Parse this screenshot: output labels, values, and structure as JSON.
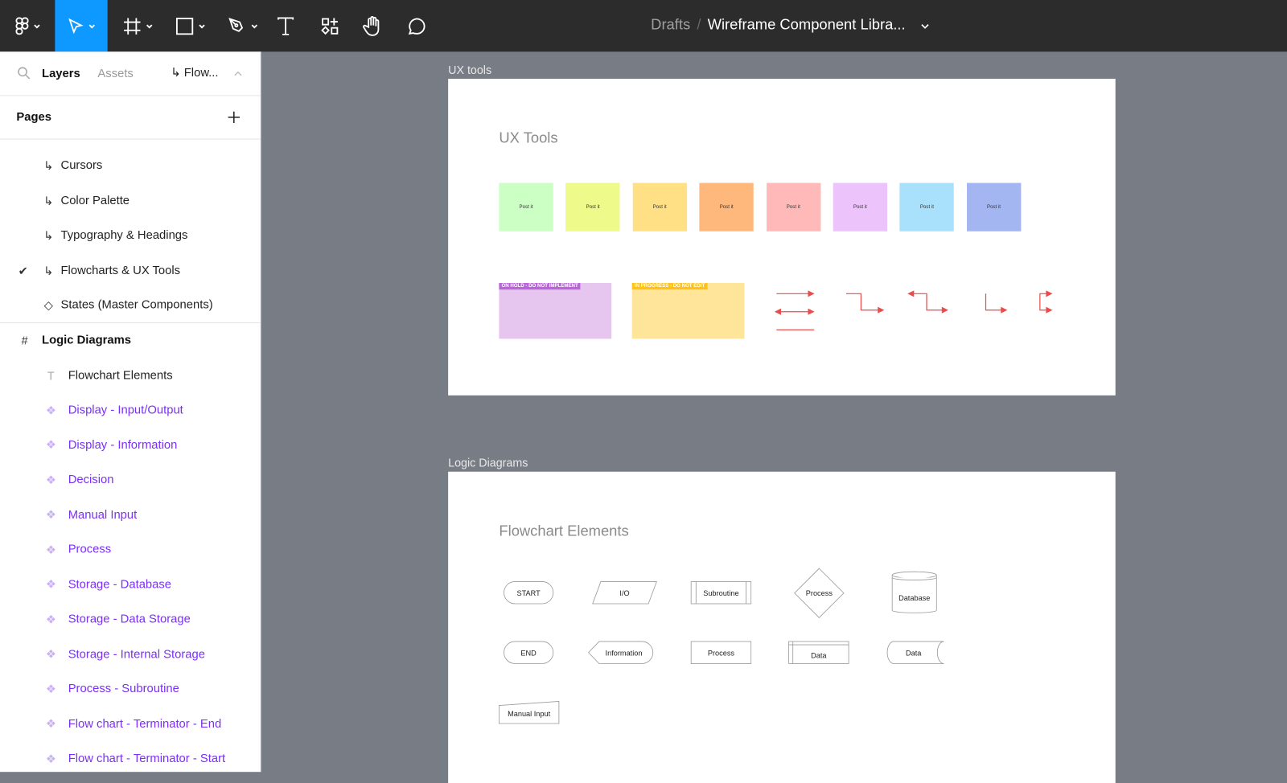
{
  "toolbar": {
    "tools": [
      "figma-menu",
      "move",
      "frame",
      "rectangle",
      "pen",
      "text",
      "resources",
      "hand",
      "comment"
    ],
    "breadcrumb_parent": "Drafts",
    "breadcrumb_sep": "/",
    "file_name": "Wireframe Component Libra..."
  },
  "sidebar": {
    "tab_layers": "Layers",
    "tab_assets": "Assets",
    "current_page": "Flow...",
    "pages_title": "Pages",
    "pages": [
      {
        "label": "Cursors",
        "type": "sub",
        "selected": false
      },
      {
        "label": "Color Palette",
        "type": "sub",
        "selected": false
      },
      {
        "label": "Typography & Headings",
        "type": "sub",
        "selected": false
      },
      {
        "label": "Flowcharts & UX Tools",
        "type": "sub",
        "selected": true
      },
      {
        "label": "States (Master Components)",
        "type": "diamond",
        "selected": false
      }
    ],
    "layers": [
      {
        "label": "Logic Diagrams",
        "type": "frame"
      },
      {
        "label": "Flowchart Elements",
        "type": "text"
      },
      {
        "label": "Display - Input/Output",
        "type": "component"
      },
      {
        "label": "Display - Information",
        "type": "component"
      },
      {
        "label": "Decision",
        "type": "component"
      },
      {
        "label": "Manual Input",
        "type": "component"
      },
      {
        "label": "Process",
        "type": "component"
      },
      {
        "label": "Storage - Database",
        "type": "component"
      },
      {
        "label": "Storage - Data Storage",
        "type": "component"
      },
      {
        "label": "Storage - Internal Storage",
        "type": "component"
      },
      {
        "label": "Process - Subroutine",
        "type": "component"
      },
      {
        "label": "Flow chart - Terminator - End",
        "type": "component"
      },
      {
        "label": "Flow chart - Terminator - Start",
        "type": "component"
      }
    ]
  },
  "canvas": {
    "ux_frame": {
      "label": "UX tools",
      "heading": "UX Tools",
      "postits": [
        {
          "label": "Post it",
          "color": "#ccffc4"
        },
        {
          "label": "Post it",
          "color": "#eefb8a"
        },
        {
          "label": "Post it",
          "color": "#ffe084"
        },
        {
          "label": "Post it",
          "color": "#ffb87c"
        },
        {
          "label": "Post it",
          "color": "#ffb9b9"
        },
        {
          "label": "Post it",
          "color": "#ecc4fb"
        },
        {
          "label": "Post it",
          "color": "#a9e0fb"
        },
        {
          "label": "Post it",
          "color": "#a4b6f2"
        }
      ],
      "status_cards": [
        {
          "tag": "ON HOLD - DO NOT IMPLEMENT",
          "tag_color": "#b964d9",
          "bg": "#e6c5ef"
        },
        {
          "tag": "IN PROGRESS - DO NOT EDIT",
          "tag_color": "#ffc21a",
          "bg": "#ffe59a"
        }
      ],
      "arrow_color": "#ec4b4b"
    },
    "logic_frame": {
      "label": "Logic Diagrams",
      "heading": "Flowchart Elements",
      "shapes": {
        "start": "START",
        "io": "I/O",
        "subroutine": "Subroutine",
        "decision": "Process",
        "database": "Database",
        "end": "END",
        "information": "Information",
        "process": "Process",
        "data_storage": "Data",
        "internal_data": "Data",
        "manual_input": "Manual Input"
      }
    }
  }
}
